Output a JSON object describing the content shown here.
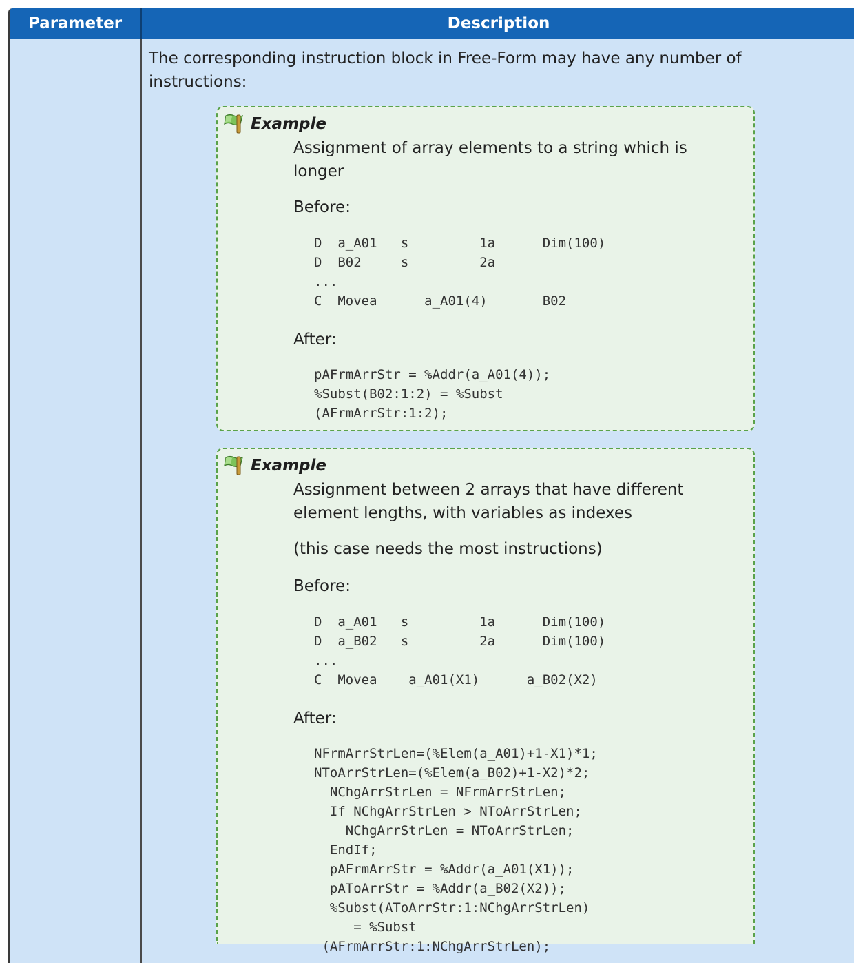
{
  "header": {
    "parameter": "Parameter",
    "description": "Description"
  },
  "intro": "The corresponding instruction block in Free-Form may have any number of instructions:",
  "examples": [
    {
      "title": "Example",
      "icon": "flag-icon",
      "description": "Assignment of array elements to a string which is longer",
      "before_label": "Before:",
      "before_code": "D  a_A01   s         1a      Dim(100)\nD  B02     s         2a\n...\nC  Movea      a_A01(4)       B02",
      "after_label": "After:",
      "after_code": "pAFrmArrStr = %Addr(a_A01(4));\n%Subst(B02:1:2) = %Subst\n(AFrmArrStr:1:2);"
    },
    {
      "title": "Example",
      "icon": "flag-icon",
      "description": "Assignment between 2 arrays that have different element lengths, with variables as indexes",
      "note": "(this case needs the most instructions)",
      "before_label": "Before:",
      "before_code": "D  a_A01   s         1a      Dim(100)\nD  a_B02   s         2a      Dim(100)\n...\nC  Movea    a_A01(X1)      a_B02(X2)",
      "after_label": "After:",
      "after_code": "NFrmArrStrLen=(%Elem(a_A01)+1-X1)*1;\nNToArrStrLen=(%Elem(a_B02)+1-X2)*2;\n  NChgArrStrLen = NFrmArrStrLen;\n  If NChgArrStrLen > NToArrStrLen;\n    NChgArrStrLen = NToArrStrLen;\n  EndIf;\n  pAFrmArrStr = %Addr(a_A01(X1));\n  pAToArrStr = %Addr(a_B02(X2));\n  %Subst(AToArrStr:1:NChgArrStrLen)\n     = %Subst\n (AFrmArrStr:1:NChgArrStrLen);"
    }
  ],
  "colors": {
    "header": "#1565b6",
    "row": "#cfe3f7",
    "example_bg": "#e9f3e8",
    "example_border": "#5aa24a"
  }
}
